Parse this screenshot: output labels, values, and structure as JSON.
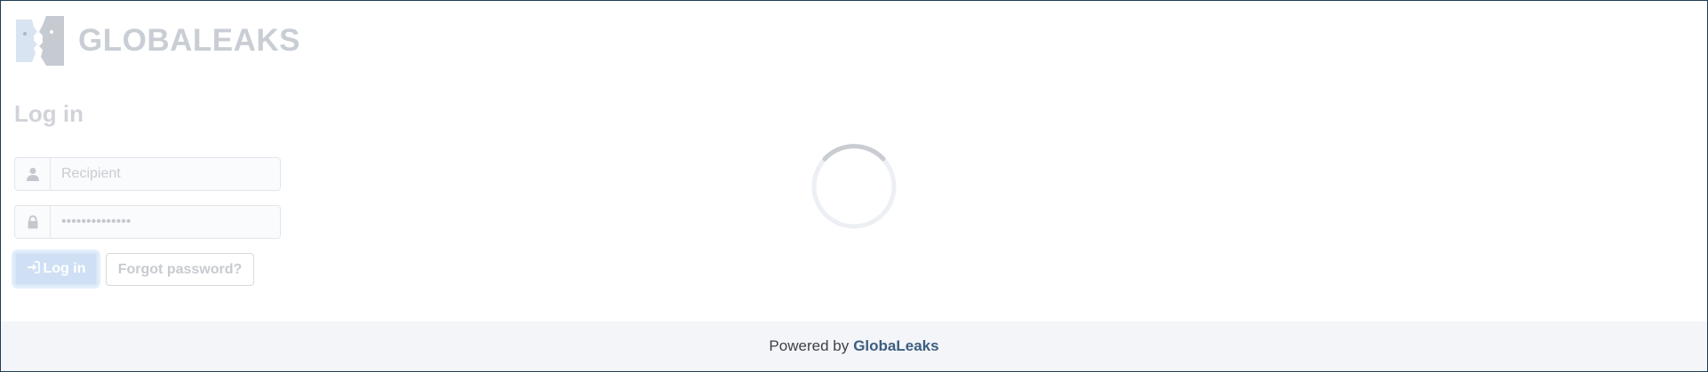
{
  "logo": {
    "text": "GLOBALEAKS",
    "icon": "globaleaks-faces-logo"
  },
  "login": {
    "title": "Log in",
    "username": {
      "placeholder": "Recipient",
      "value": "",
      "icon": "user-icon"
    },
    "password": {
      "value": "••••••••••••••",
      "icon": "lock-icon"
    },
    "login_button": "Log in",
    "forgot_button": "Forgot password?"
  },
  "loading": {
    "indicator": "spinner"
  },
  "footer": {
    "prefix": "Powered by",
    "brand": "GlobaLeaks"
  },
  "colors": {
    "frame": "#1f3e55",
    "footer_bg": "#f4f5f9",
    "brand_link": "#3c5e80",
    "login_button_bg": "#cfe0f5"
  }
}
